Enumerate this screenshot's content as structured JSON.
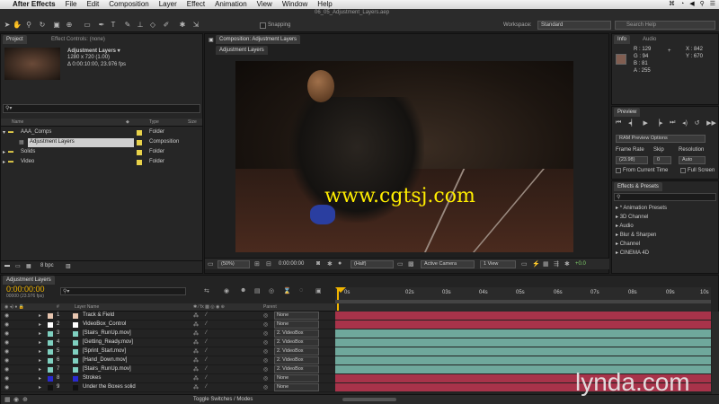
{
  "menubar": {
    "app": "After Effects",
    "items": [
      "File",
      "Edit",
      "Composition",
      "Layer",
      "Effect",
      "Animation",
      "View",
      "Window",
      "Help"
    ]
  },
  "toolbar": {
    "document": "06_05_Adjustment_Layers.aep",
    "snapping": "Snapping",
    "workspace_label": "Workspace:",
    "workspace": "Standard",
    "search_help": "Search Help"
  },
  "project": {
    "tabs": [
      "Project",
      "Effect Controls: (none)"
    ],
    "selected_name": "Adjustment Layers ▾",
    "selected_info1": "1280 x 720 (1.00)",
    "selected_info2": "Δ 0:00:10:00, 23.976 fps",
    "columns": {
      "name": "Name",
      "type": "Type",
      "size": "Size"
    },
    "items": [
      {
        "name": "AAA_Comps",
        "type": "Folder",
        "color": "#e8d24a"
      },
      {
        "name": "Adjustment Layers",
        "type": "Composition",
        "color": "#e8d24a"
      },
      {
        "name": "Solids",
        "type": "Folder",
        "color": "#e8d24a"
      },
      {
        "name": "Video",
        "type": "Folder",
        "color": "#e8d24a"
      }
    ],
    "bpc": "8 bpc"
  },
  "composition": {
    "tab": "Composition: Adjustment Layers",
    "subtab": "Adjustment Layers",
    "watermark": "www.cgtsj.com",
    "controls": {
      "zoom": "(50%)",
      "time": "0:00:00:00",
      "resolution": "(Half)",
      "camera": "Active Camera",
      "view": "1 View",
      "exposure": "+0.0"
    }
  },
  "info": {
    "tabs": [
      "Info",
      "Audio"
    ],
    "r": "R : 129",
    "g": "G : 94",
    "b": "B : 81",
    "a": "A : 255",
    "x": "X : 842",
    "y": "Y : 670",
    "swatch": "#815e51"
  },
  "preview": {
    "title": "Preview",
    "ram": "RAM Preview Options",
    "frame_rate_label": "Frame Rate",
    "skip_label": "Skip",
    "resolution_label": "Resolution",
    "frame_rate": "(23.98)",
    "skip": "0",
    "resolution": "Auto",
    "from_current": "From Current Time",
    "full_screen": "Full Screen"
  },
  "effects": {
    "title": "Effects & Presets",
    "items": [
      "* Animation Presets",
      "3D Channel",
      "Audio",
      "Blur & Sharpen",
      "Channel",
      "CINEMA 4D"
    ]
  },
  "timeline": {
    "tab": "Adjustment Layers",
    "timecode": "0:00:00:00",
    "fps": "00000 (23.976 fps)",
    "layer_name_header": "Layer Name",
    "parent_header": "Parent",
    "ruler": [
      "0s",
      "02s",
      "03s",
      "04s",
      "05s",
      "06s",
      "07s",
      "08s",
      "09s",
      "10s"
    ],
    "toggle": "Toggle Switches / Modes",
    "layers": [
      {
        "num": "1",
        "name": "Track & Field",
        "parent": "None",
        "color": "#e8c6b0",
        "bar": "#a8334a"
      },
      {
        "num": "2",
        "name": "VideoBox_Control",
        "parent": "None",
        "color": "#ffffff",
        "bar": "#a8334a"
      },
      {
        "num": "3",
        "name": "[Stairs_RunUp.mov]",
        "parent": "2. VideoBox",
        "color": "#7fd0c0",
        "bar": "#6fa89c"
      },
      {
        "num": "4",
        "name": "[Getting_Ready.mov]",
        "parent": "2. VideoBox",
        "color": "#7fd0c0",
        "bar": "#6fa89c"
      },
      {
        "num": "5",
        "name": "[Sprint_Start.mov]",
        "parent": "2. VideoBox",
        "color": "#7fd0c0",
        "bar": "#6fa89c"
      },
      {
        "num": "6",
        "name": "[Hand_Down.mov]",
        "parent": "2. VideoBox",
        "color": "#7fd0c0",
        "bar": "#6fa89c"
      },
      {
        "num": "7",
        "name": "[Stairs_RunUp.mov]",
        "parent": "2. VideoBox",
        "color": "#7fd0c0",
        "bar": "#6fa89c"
      },
      {
        "num": "8",
        "name": "Strokes",
        "parent": "None",
        "color": "#2a2ad0",
        "bar": "#a8334a"
      },
      {
        "num": "9",
        "name": "Under the Boxes solid",
        "parent": "None",
        "color": "#111111",
        "bar": "#a8334a"
      }
    ]
  },
  "lynda": "lynda.com"
}
